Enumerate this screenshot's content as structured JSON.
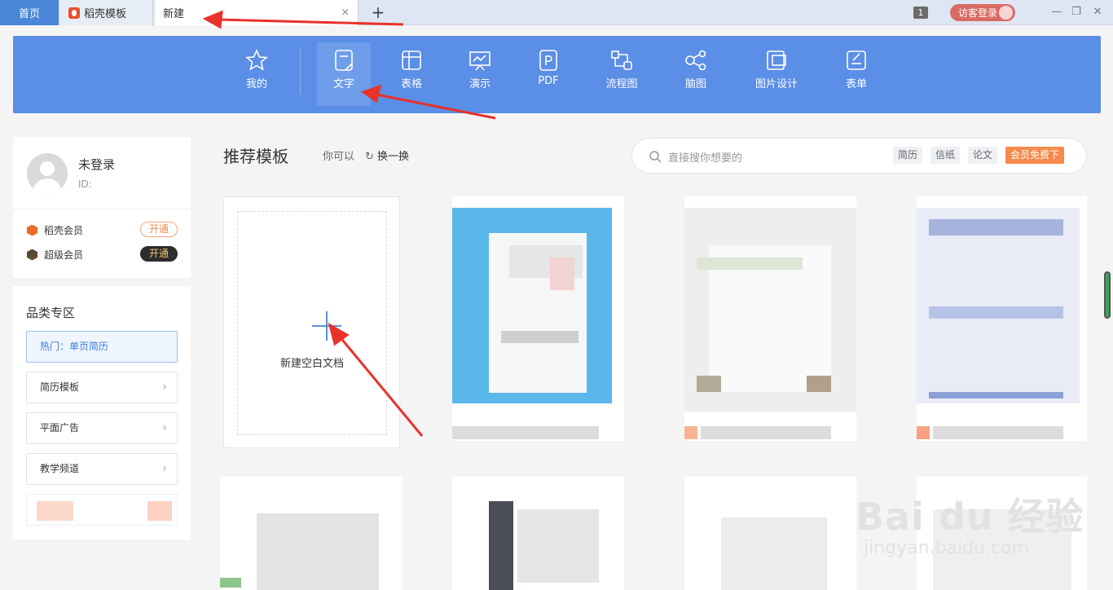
{
  "tabs": {
    "home": "首页",
    "daoke": "稻壳模板",
    "new": "新建",
    "add": "+",
    "close": "×"
  },
  "topbar": {
    "count": "1",
    "guest_login": "访客登录",
    "minimize": "—",
    "restore": "❐",
    "close": "✕"
  },
  "toolbar": {
    "items": [
      {
        "label": "我的",
        "icon": "star-icon"
      },
      {
        "label": "文字",
        "icon": "writer-doc-icon"
      },
      {
        "label": "表格",
        "icon": "spreadsheet-icon"
      },
      {
        "label": "演示",
        "icon": "presentation-icon"
      },
      {
        "label": "PDF",
        "icon": "pdf-icon"
      },
      {
        "label": "流程图",
        "icon": "flowchart-icon"
      },
      {
        "label": "脑图",
        "icon": "mindmap-icon"
      },
      {
        "label": "图片设计",
        "icon": "image-design-icon"
      },
      {
        "label": "表单",
        "icon": "form-icon"
      }
    ],
    "active": "文字",
    "bg_color": "#5b8ee6"
  },
  "user": {
    "name": "未登录",
    "id_label": "ID:",
    "memberships": [
      {
        "label": "稻壳会员",
        "action": "开通",
        "icon": "daoke-member-icon"
      },
      {
        "label": "超级会员",
        "action": "开通",
        "icon": "super-member-icon"
      }
    ]
  },
  "categories": {
    "title": "品类专区",
    "hot": "热门：单页简历",
    "items": [
      "简历模板",
      "平面广告",
      "教学频道"
    ]
  },
  "main": {
    "title": "推荐模板",
    "may_like": "你可以",
    "refresh": "换一换",
    "search_placeholder": "直接搜你想要的",
    "tags": [
      "简历",
      "信纸",
      "论文"
    ],
    "vip_tag": "会员免费下",
    "blank_doc": "新建空白文档"
  },
  "watermark": {
    "main": "Bai du 经验",
    "sub": "jingyan.baidu.com"
  }
}
